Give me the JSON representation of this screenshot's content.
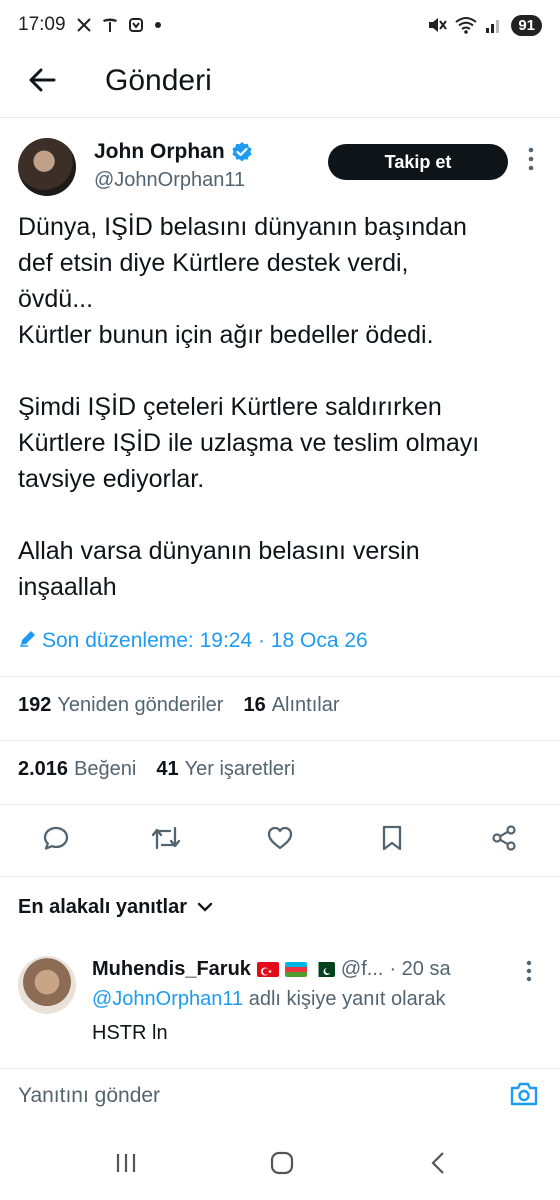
{
  "status_bar": {
    "time": "17:09",
    "left_icons": [
      "x-icon",
      "tesla-icon",
      "app-icon",
      "dot-icon"
    ],
    "right_icons": [
      "mute-icon",
      "wifi-icon",
      "signal-icon"
    ],
    "battery": "91"
  },
  "header": {
    "title": "Gönderi",
    "back_icon": "arrow-left-icon"
  },
  "author": {
    "name": "John Orphan",
    "handle": "@JohnOrphan11",
    "verified": true,
    "follow_label": "Takip et"
  },
  "tweet": {
    "text": "Dünya, IŞİD belasını dünyanın başından\ndef etsin diye Kürtlere destek verdi,\növdü...\nKürtler bunun için ağır bedeller ödedi.\n\nŞimdi IŞİD çeteleri Kürtlere saldırırken\nKürtlere IŞİD ile uzlaşma ve teslim olmayı\ntavsiye ediyorlar.\n\nAllah varsa dünyanın belasını versin\ninşaallah",
    "edited_label": "Son düzenleme: 19:24 · 18 Oca 26"
  },
  "stats": {
    "reposts": "192",
    "reposts_label": "Yeniden gönderiler",
    "quotes": "16",
    "quotes_label": "Alıntılar",
    "likes": "2.016",
    "likes_label": "Beğeni",
    "bookmarks": "41",
    "bookmarks_label": "Yer işaretleri"
  },
  "actions": [
    "reply-icon",
    "repost-icon",
    "like-icon",
    "bookmark-icon",
    "share-icon"
  ],
  "replies_section": {
    "label": "En alakalı yanıtlar"
  },
  "reply": {
    "name": "Muhendis_Faruk",
    "flags": [
      "turkey",
      "azerbaijan",
      "pakistan"
    ],
    "handle": "@f...",
    "time": "· 20 sa",
    "reply_to_mention": "@JohnOrphan11",
    "reply_to_suffix": " adlı kişiye yanıt olarak",
    "text": "HSTR ln"
  },
  "compose": {
    "placeholder": "Yanıtını gönder"
  },
  "colors": {
    "accent": "#1d9bf0",
    "text": "#0f1419",
    "secondary": "#536471"
  }
}
